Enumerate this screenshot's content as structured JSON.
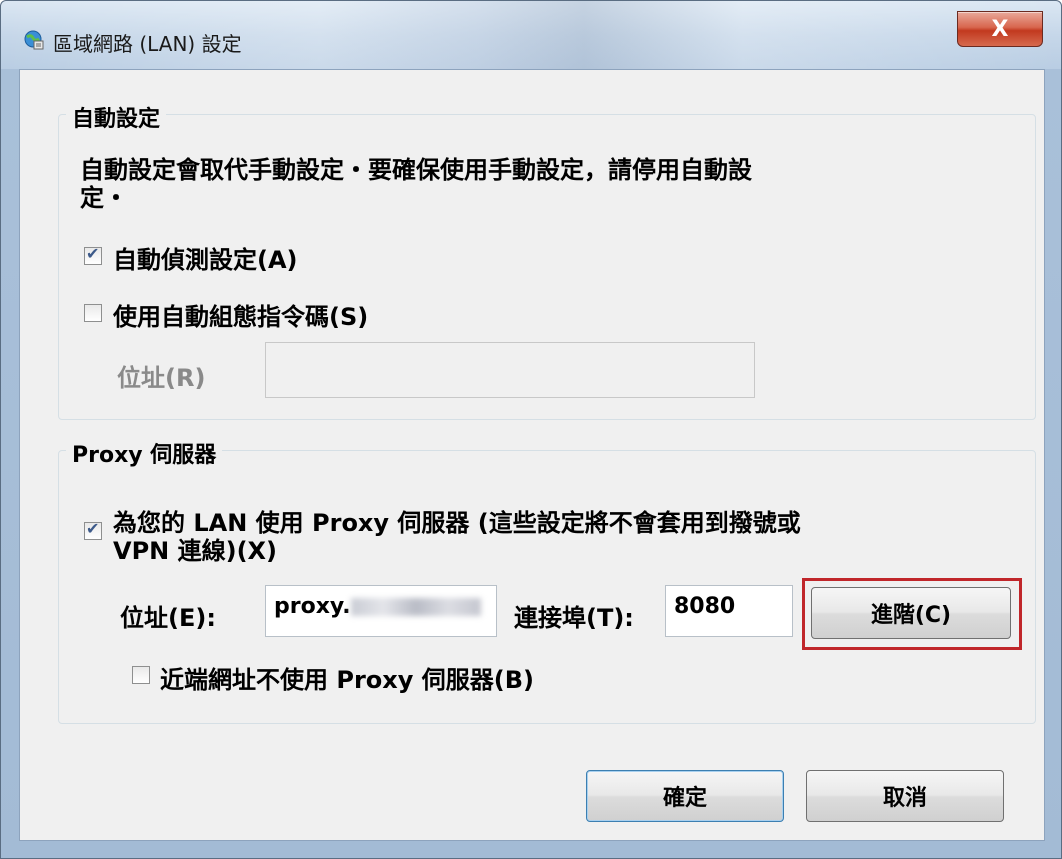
{
  "window": {
    "title": "區域網路 (LAN) 設定",
    "close_label": "X"
  },
  "auto_config": {
    "group_label": "自動設定",
    "description": "自動設定會取代手動設定・要確保使用手動設定，請停用自動設定・",
    "description_line1": "自動設定會取代手動設定・要確保使用手動設定，請停用自動設",
    "description_line2": "定・",
    "auto_detect": {
      "label": "自動偵測設定(A)",
      "checked": true
    },
    "use_script": {
      "label": "使用自動組態指令碼(S)",
      "checked": false
    },
    "address_label": "位址(R)",
    "address_value": ""
  },
  "proxy": {
    "group_label": "Proxy 伺服器",
    "use_proxy": {
      "label_line1": "為您的 LAN 使用 Proxy 伺服器 (這些設定將不會套用到撥號或",
      "label_line2": "VPN 連線)(X)",
      "checked": true
    },
    "address_label": "位址(E):",
    "address_value": "proxy.",
    "port_label": "連接埠(T):",
    "port_value": "8080",
    "advanced_label": "進階(C)",
    "bypass_local": {
      "label": "近端網址不使用 Proxy 伺服器(B)",
      "checked": false
    }
  },
  "footer": {
    "ok_label": "確定",
    "cancel_label": "取消"
  },
  "colors": {
    "highlight": "#c0262a",
    "close_button": "#c2391f"
  }
}
